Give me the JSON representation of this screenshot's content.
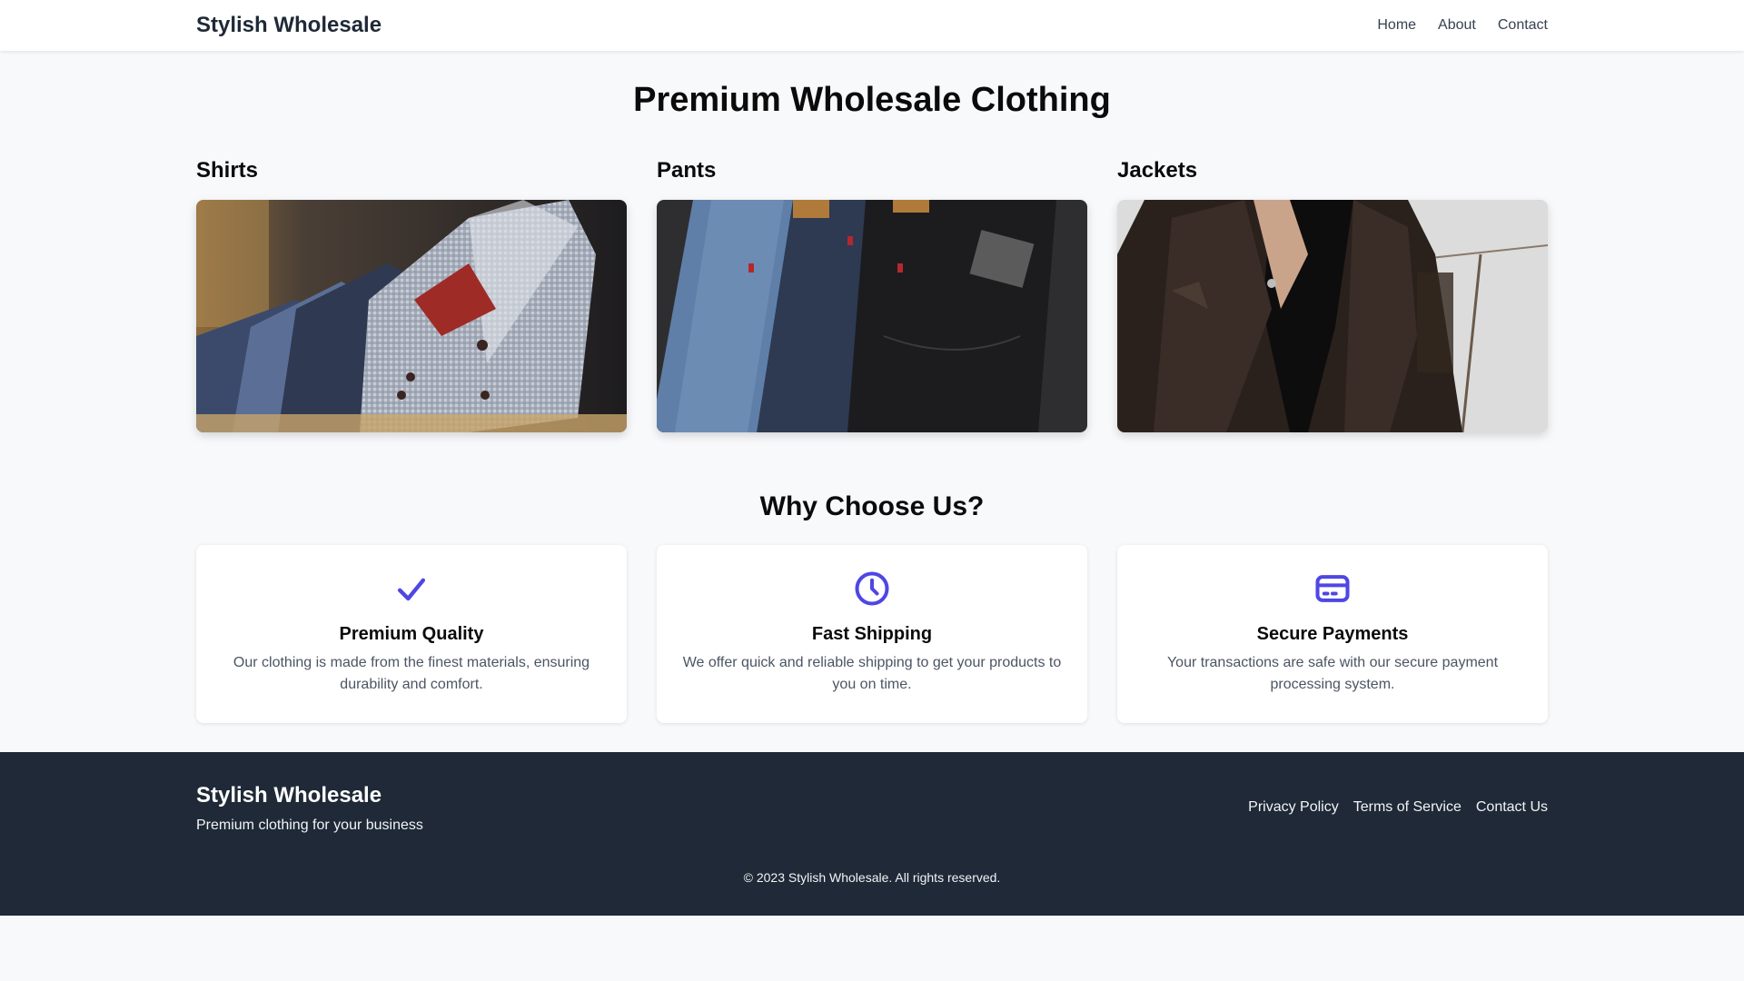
{
  "header": {
    "brand": "Stylish Wholesale",
    "nav": [
      "Home",
      "About",
      "Contact"
    ]
  },
  "hero": {
    "title": "Premium Wholesale Clothing"
  },
  "categories": [
    {
      "title": "Shirts",
      "image": "shirts-photo"
    },
    {
      "title": "Pants",
      "image": "pants-photo"
    },
    {
      "title": "Jackets",
      "image": "jackets-photo"
    }
  ],
  "why": {
    "title": "Why Choose Us?",
    "features": [
      {
        "icon": "check-icon",
        "title": "Premium Quality",
        "desc": "Our clothing is made from the finest materials, ensuring durability and comfort."
      },
      {
        "icon": "clock-icon",
        "title": "Fast Shipping",
        "desc": "We offer quick and reliable shipping to get your products to you on time."
      },
      {
        "icon": "credit-card-icon",
        "title": "Secure Payments",
        "desc": "Your transactions are safe with our secure payment processing system."
      }
    ]
  },
  "footer": {
    "brand": "Stylish Wholesale",
    "tagline": "Premium clothing for your business",
    "links": [
      "Privacy Policy",
      "Terms of Service",
      "Contact Us"
    ],
    "copyright": "© 2023 Stylish Wholesale. All rights reserved."
  },
  "colors": {
    "accent": "#4f46e5",
    "footer_bg": "#1f2937",
    "page_bg": "#f8f9fb"
  }
}
